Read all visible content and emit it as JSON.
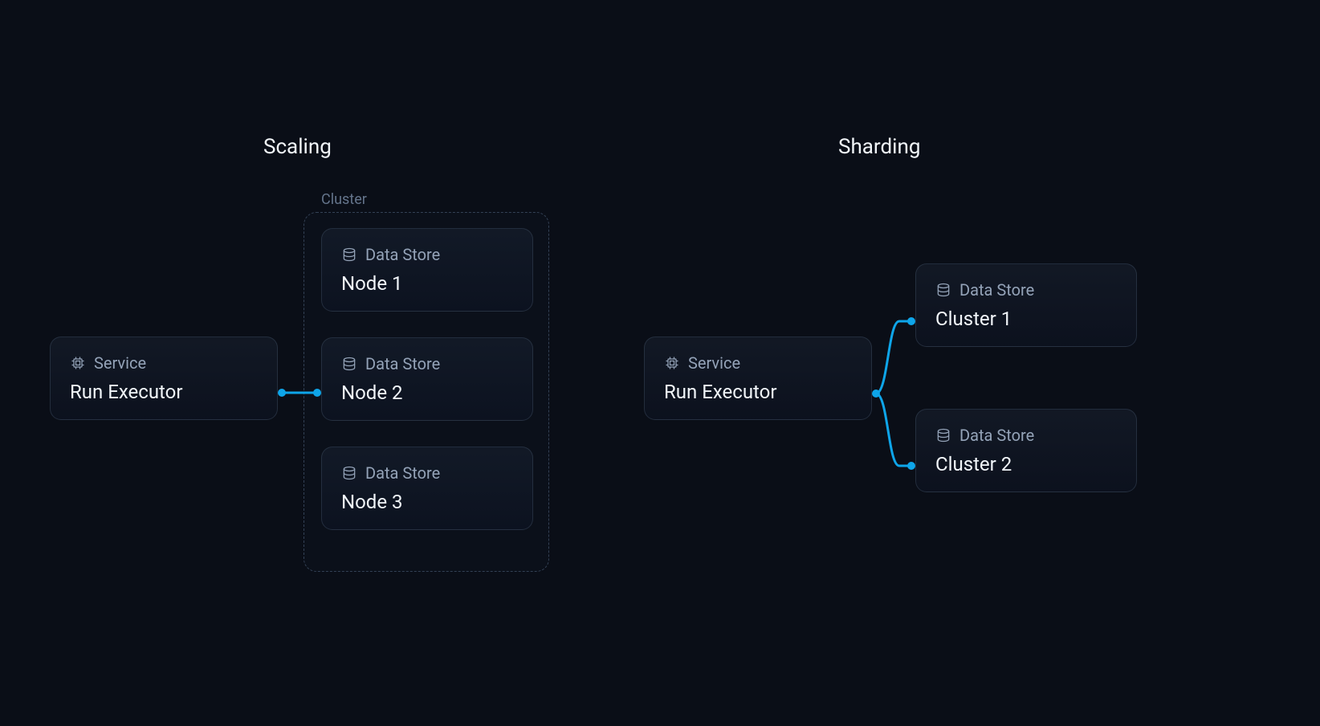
{
  "scaling": {
    "title": "Scaling",
    "cluster_label": "Cluster",
    "service": {
      "type": "Service",
      "name": "Run Executor"
    },
    "nodes": [
      {
        "type": "Data Store",
        "name": "Node 1"
      },
      {
        "type": "Data Store",
        "name": "Node 2"
      },
      {
        "type": "Data Store",
        "name": "Node 3"
      }
    ]
  },
  "sharding": {
    "title": "Sharding",
    "service": {
      "type": "Service",
      "name": "Run Executor"
    },
    "clusters": [
      {
        "type": "Data Store",
        "name": "Cluster 1"
      },
      {
        "type": "Data Store",
        "name": "Cluster 2"
      }
    ]
  }
}
